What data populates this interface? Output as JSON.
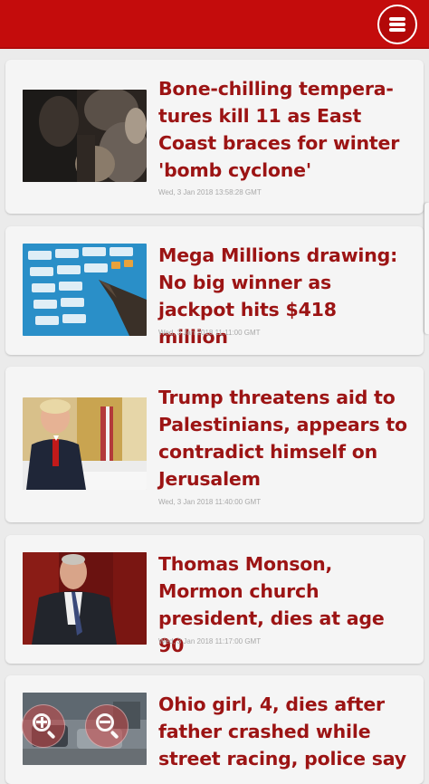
{
  "header": {
    "menu_icon": "hamburger-menu-icon",
    "accent_color": "#c40c0c",
    "title_color": "#9c1414"
  },
  "articles": [
    {
      "title": "Bone-chilling tempera-tures kill 11 as East Coast braces for winter 'bomb cyclone'",
      "date": "Wed, 3 Jan 2018 13:58:28 GMT",
      "thumbnail": "photo-cold-weather-crowd"
    },
    {
      "title": "Mega Millions drawing: No big winner as jackpot hits $418 million",
      "date": "Wed, 3 Jan 2018 11:11:00 GMT",
      "thumbnail": "photo-lottery-tickets"
    },
    {
      "title": "Trump threatens aid to Palestinians, appears to contradict himself on Jerusalem",
      "date": "Wed, 3 Jan 2018 11:40:00 GMT",
      "thumbnail": "photo-trump-desk"
    },
    {
      "title": "Thomas Monson, Mormon church president, dies at age 90",
      "date": "Wed, 3 Jan 2018 11:17:00 GMT",
      "thumbnail": "photo-thomas-monson"
    },
    {
      "title": "Ohio girl, 4, dies after father crashed while street racing, police say",
      "date": "",
      "thumbnail": "photo-street-crash"
    }
  ],
  "zoom_controls": {
    "zoom_in_icon": "zoom-in-icon",
    "zoom_out_icon": "zoom-out-icon"
  }
}
